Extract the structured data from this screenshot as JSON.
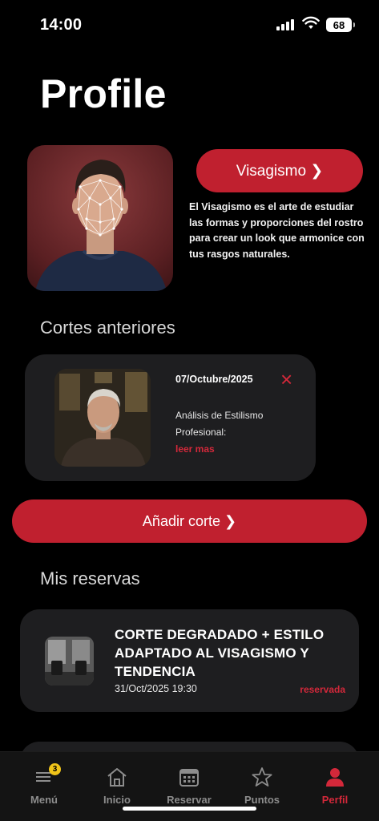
{
  "status_bar": {
    "time": "14:00",
    "battery": "68"
  },
  "header": {
    "title": "Profile"
  },
  "visagismo": {
    "button_label": "Visagismo ❯",
    "description": "El Visagismo es el arte de estudiar las formas y proporciones del rostro para crear un look que armonice con tus rasgos naturales."
  },
  "cortes": {
    "section_title": "Cortes anteriores",
    "items": [
      {
        "date": "07/Octubre/2025",
        "delete_icon": "×",
        "description": "Análisis de Estilismo Profesional:",
        "link": "leer mas"
      }
    ]
  },
  "add_corte": {
    "label": "Añadir corte ❯"
  },
  "reservas": {
    "section_title": "Mis reservas",
    "items": [
      {
        "title": "CORTE DEGRADADO + ESTILO ADAPTADO AL VISAGISMO Y TENDENCIA",
        "datetime": "31/Oct/2025 19:30",
        "status": "reservada"
      }
    ]
  },
  "tabbar": {
    "items": [
      {
        "label": "Menú",
        "icon": "menu-icon",
        "badge": "3"
      },
      {
        "label": "Inicio",
        "icon": "home-icon"
      },
      {
        "label": "Reservar",
        "icon": "calendar-icon"
      },
      {
        "label": "Puntos",
        "icon": "star-icon"
      },
      {
        "label": "Perfil",
        "icon": "person-icon"
      }
    ],
    "active_color": "#d3283a",
    "inactive_color": "#8d8d8d"
  },
  "colors": {
    "accent": "#c0202f",
    "card": "#1e1e20",
    "background": "#000000"
  }
}
